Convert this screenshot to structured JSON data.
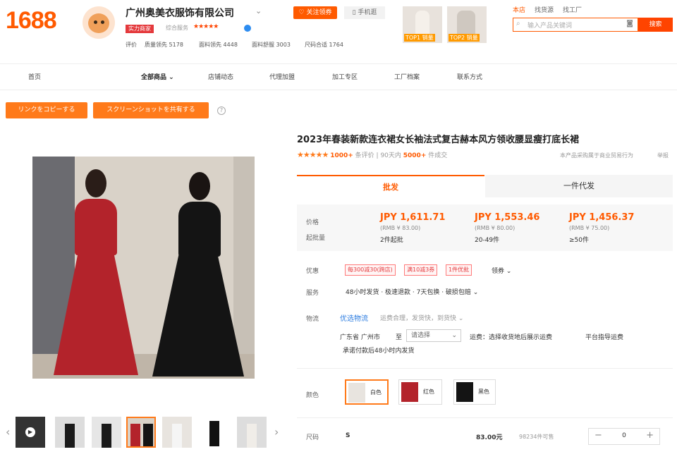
{
  "header": {
    "logo": "1688",
    "shop_name": "广州奥美衣服饰有限公司",
    "follow_label": "关注领券",
    "mobile_label": "手机逛",
    "badge": "实力商家",
    "grade_label": "综合服务",
    "stars": "★★★★★",
    "ratings": [
      {
        "label": "评价",
        "value": ""
      },
      {
        "label": "质量领先",
        "value": "5178"
      },
      {
        "label": "面料领先",
        "value": "4448"
      },
      {
        "label": "面料舒服",
        "value": "3003"
      },
      {
        "label": "尺码合适",
        "value": "1764"
      }
    ],
    "top_products": [
      "TOP1 销量",
      "TOP2 销量"
    ],
    "links": [
      "本店",
      "找货源",
      "找工厂"
    ],
    "search_placeholder": "输入产品关键词",
    "search_button": "搜索"
  },
  "nav": {
    "items": [
      "首页",
      "全部商品",
      "店铺动态",
      "代理加盟",
      "加工专区",
      "工厂档案",
      "联系方式"
    ]
  },
  "actions": {
    "copy_link": "リンクをコピーする",
    "share_screenshot": "スクリーンショットを共有する",
    "help": "?"
  },
  "product": {
    "title": "2023年春装新款连衣裙女长袖法式复古赫本风方领收腰显瘦打底长裙",
    "stars": "★★★★★",
    "reviews_count": "1000+",
    "reviews_label": "条评价",
    "sold_prefix": "90天内",
    "sold_count": "5000+",
    "sold_label": "件成交",
    "trade_note": "本产品采购属于商业贸易行为",
    "report": "举报",
    "tabs": [
      "批发",
      "一件代发"
    ],
    "price_label": "价格",
    "moq_label": "起批量",
    "tiers": [
      {
        "price": "JPY 1,611.71",
        "rmb": "(RMB ¥ 83.00)",
        "qty": "2件起批"
      },
      {
        "price": "JPY 1,553.46",
        "rmb": "(RMB ¥ 80.00)",
        "qty": "20-49件"
      },
      {
        "price": "JPY 1,456.37",
        "rmb": "(RMB ¥ 75.00)",
        "qty": "≥50件"
      }
    ],
    "promo_label": "优惠",
    "coupons": [
      "每300减30(跨店)",
      "满10减3券",
      "1件优批"
    ],
    "coupon_more": "领券",
    "service_label": "服务",
    "service_text": "48小时发货 · 极速退款 · 7天包换 · 破损包赔",
    "logistics_label": "物流",
    "logistics_brand": "优选物流",
    "logistics_desc": "运费合理，发货快，到货快",
    "origin": "广东省 广州市",
    "to_label": "至",
    "select_placeholder": "请选择",
    "freight_note": "运费：选择收货地后展示运费",
    "platform_note": "平台指导运费",
    "ship_promise": "承诺付款后48小时内发货",
    "color_label": "颜色",
    "colors": [
      "白色",
      "红色",
      "黑色"
    ],
    "size_label": "尺码",
    "size_value": "S",
    "size_price": "83.00元",
    "stock": "98234件可售",
    "qty": "0",
    "minus": "−",
    "plus": "+"
  },
  "colors": {
    "accent": "#ff5a00",
    "red_dress": "#b3232b",
    "black_dress": "#141414"
  }
}
